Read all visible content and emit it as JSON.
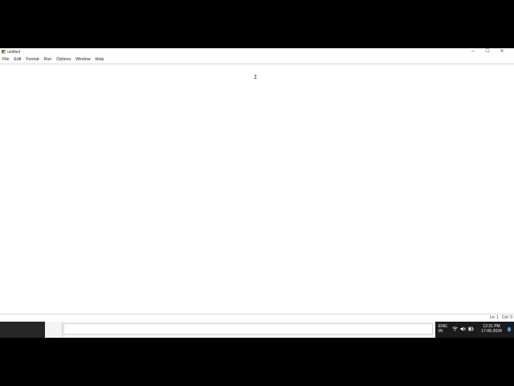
{
  "window": {
    "title": "untitled",
    "app_icon": "python-idle-icon",
    "controls": {
      "minimize": "─",
      "maximize": "☐",
      "close": "✕"
    }
  },
  "menubar": {
    "items": [
      {
        "label": "File"
      },
      {
        "label": "Edit"
      },
      {
        "label": "Format"
      },
      {
        "label": "Run"
      },
      {
        "label": "Options"
      },
      {
        "label": "Window"
      },
      {
        "label": "Help"
      }
    ]
  },
  "editor": {
    "cursor_glyph": "I"
  },
  "statusbar": {
    "line": "Ln: 1",
    "col": "Col: 0"
  },
  "taskbar": {
    "language_top": "ENG",
    "language_bottom": "IN",
    "wifi_icon": "wifi-icon",
    "volume_icon": "volume-icon",
    "battery_icon": "battery-icon",
    "time": "12:31 PM",
    "date": "17-06-2024",
    "notification_icon": "notification-bell-icon"
  }
}
